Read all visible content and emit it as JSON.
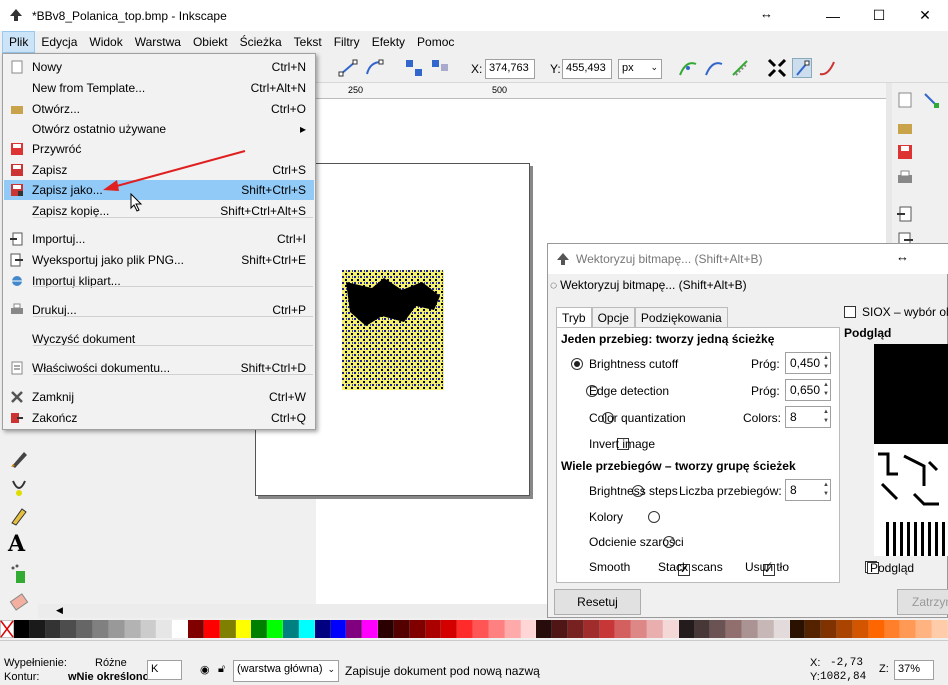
{
  "window": {
    "title": "*BBv8_Polanica_top.bmp - Inkscape",
    "minimize": "—",
    "maximize": "☐",
    "close": "✕",
    "move_glyph": "↔"
  },
  "menubar": [
    "Plik",
    "Edycja",
    "Widok",
    "Warstwa",
    "Obiekt",
    "Ścieżka",
    "Tekst",
    "Filtry",
    "Efekty",
    "Pomoc"
  ],
  "toolbar": {
    "x_label": "X:",
    "x_value": "374,763",
    "y_label": "Y:",
    "y_value": "455,493",
    "unit": "px"
  },
  "ruler": {
    "marks": [
      "250",
      "500"
    ]
  },
  "file_menu": [
    {
      "icon": "new-doc-icon",
      "label": "Nowy",
      "shortcut": "Ctrl+N"
    },
    {
      "icon": "",
      "label": "New from Template...",
      "shortcut": "Ctrl+Alt+N"
    },
    {
      "icon": "folder-icon",
      "label": "Otwórz...",
      "shortcut": "Ctrl+O"
    },
    {
      "icon": "",
      "label": "Otwórz ostatnio używane",
      "shortcut": "",
      "submenu": "▸"
    },
    {
      "icon": "revert-icon",
      "label": "Przywróć",
      "shortcut": ""
    },
    {
      "icon": "save-icon",
      "label": "Zapisz",
      "shortcut": "Ctrl+S"
    },
    {
      "icon": "save-as-icon",
      "label": "Zapisz jako...",
      "shortcut": "Shift+Ctrl+S",
      "highlighted": true
    },
    {
      "icon": "",
      "label": "Zapisz kopię...",
      "shortcut": "Shift+Ctrl+Alt+S"
    },
    {
      "icon": "import-icon",
      "label": "Importuj...",
      "shortcut": "Ctrl+I"
    },
    {
      "icon": "export-png-icon",
      "label": "Wyeksportuj jako plik PNG...",
      "shortcut": "Shift+Ctrl+E"
    },
    {
      "icon": "clipart-icon",
      "label": "Importuj klipart...",
      "shortcut": ""
    },
    {
      "icon": "print-icon",
      "label": "Drukuj...",
      "shortcut": "Ctrl+P"
    },
    {
      "icon": "",
      "label": "Wyczyść dokument",
      "shortcut": ""
    },
    {
      "icon": "doc-props-icon",
      "label": "Właściwości dokumentu...",
      "shortcut": "Shift+Ctrl+D"
    },
    {
      "icon": "close-x-icon",
      "label": "Zamknij",
      "shortcut": "Ctrl+W"
    },
    {
      "icon": "quit-icon",
      "label": "Zakończ",
      "shortcut": "Ctrl+Q"
    }
  ],
  "dialog": {
    "title": "Wektoryzuj bitmapę... (Shift+Alt+B)",
    "subtitle": "Wektoryzuj bitmapę... (Shift+Alt+B)",
    "tabs": [
      "Tryb",
      "Opcje",
      "Podziękowania"
    ],
    "single_heading": "Jeden przebieg: tworzy jedną ścieżkę",
    "brightness_cutoff": "Brightness cutoff",
    "prog1_label": "Próg:",
    "prog1": "0,450",
    "edge_detection": "Edge detection",
    "prog2_label": "Próg:",
    "prog2": "0,650",
    "color_quant": "Color quantization",
    "colors_label": "Colors:",
    "colors": "8",
    "invert": "Invert image",
    "multi_heading": "Wiele przebiegów – tworzy grupę ścieżek",
    "brightness_steps": "Brightness steps",
    "passes_label": "Liczba przebiegów:",
    "passes": "8",
    "kolory": "Kolory",
    "szarosci": "Odcienie szarości",
    "smooth": "Smooth",
    "stack": "Stack scans",
    "remove_bg": "Usuń tło",
    "siox": "SIOX – wybór ob",
    "preview_label": "Podgląd",
    "preview_check": "Podgląd",
    "reset": "Resetuj",
    "stop": "Zatrzym"
  },
  "status": {
    "fill_label": "Wypełnienie:",
    "fill_value": "Różne",
    "stroke_label": "Kontur:",
    "stroke_value": "wNie określono",
    "opacity_prefix": "K",
    "layer": "(warstwa główna)",
    "message": "Zapisuje dokument pod nową nazwą",
    "x_label": "X:",
    "x": "-2,73",
    "y_label": "Y:",
    "y": "1082,84",
    "z_label": "Z:",
    "zoom": "37%"
  },
  "colors": {
    "accent": "#91c9f7",
    "arrow": "#e02020"
  }
}
